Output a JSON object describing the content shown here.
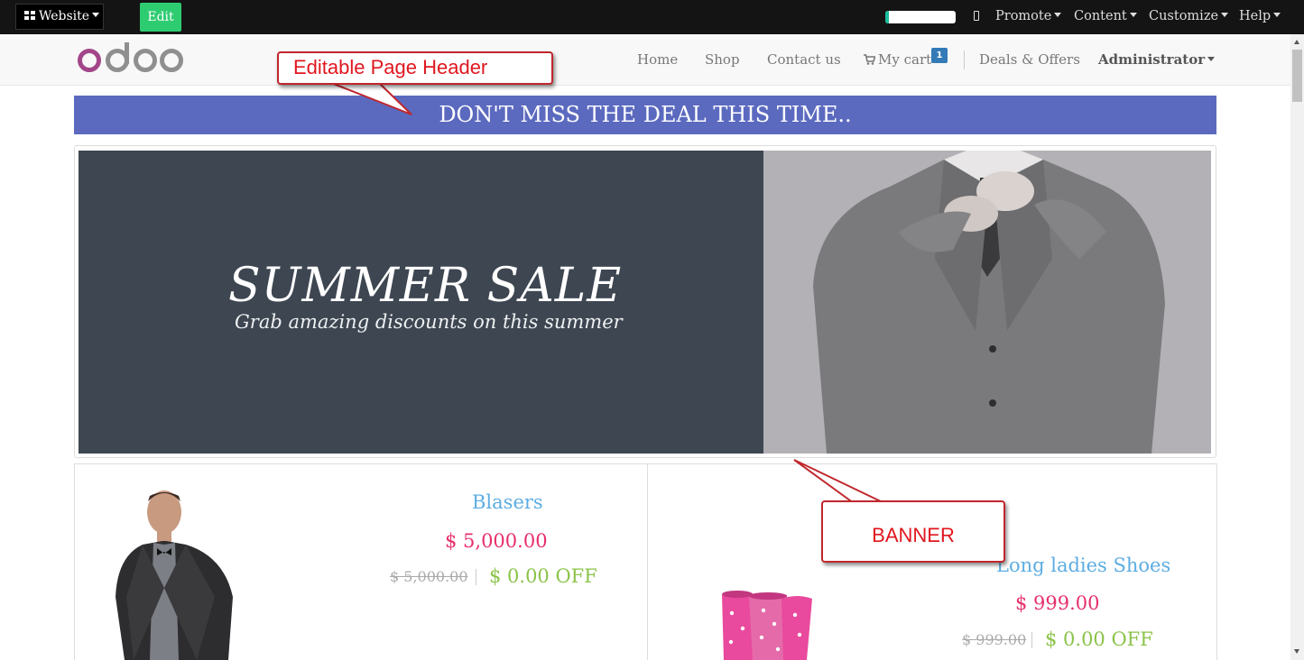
{
  "admin_bar": {
    "website_label": "Website",
    "edit_label": "Edit",
    "progress_fraction": 0.05,
    "menus": [
      "Promote",
      "Content",
      "Customize",
      "Help"
    ]
  },
  "navbar": {
    "logo_text": "odoo",
    "items": [
      "Home",
      "Shop",
      "Contact us"
    ],
    "cart_label": "My cart",
    "cart_count": "1",
    "deals_label": "Deals & Offers",
    "user_label": "Administrator"
  },
  "deal_banner": {
    "text": "DON'T MISS THE DEAL THIS TIME..",
    "color": "#5b6abf"
  },
  "hero": {
    "title": "SUMMER SALE",
    "subtitle": "Grab amazing discounts on this summer"
  },
  "products": [
    {
      "name": "Blasers",
      "price": "$ 5,000.00",
      "old_price": "$ 5,000.00",
      "discount": "$ 0.00 OFF"
    },
    {
      "name": "Long ladies Shoes",
      "price": "$ 999.00",
      "old_price": "$ 999.00",
      "discount": "$ 0.00 OFF"
    }
  ],
  "annotations": {
    "header_callout": "Editable Page Header",
    "banner_callout": "BANNER"
  },
  "colors": {
    "accent_green": "#2ecc71",
    "price_pink": "#e7306b",
    "discount_green": "#8bc34a",
    "name_blue": "#5dade2",
    "callout_red": "#e0171f"
  }
}
